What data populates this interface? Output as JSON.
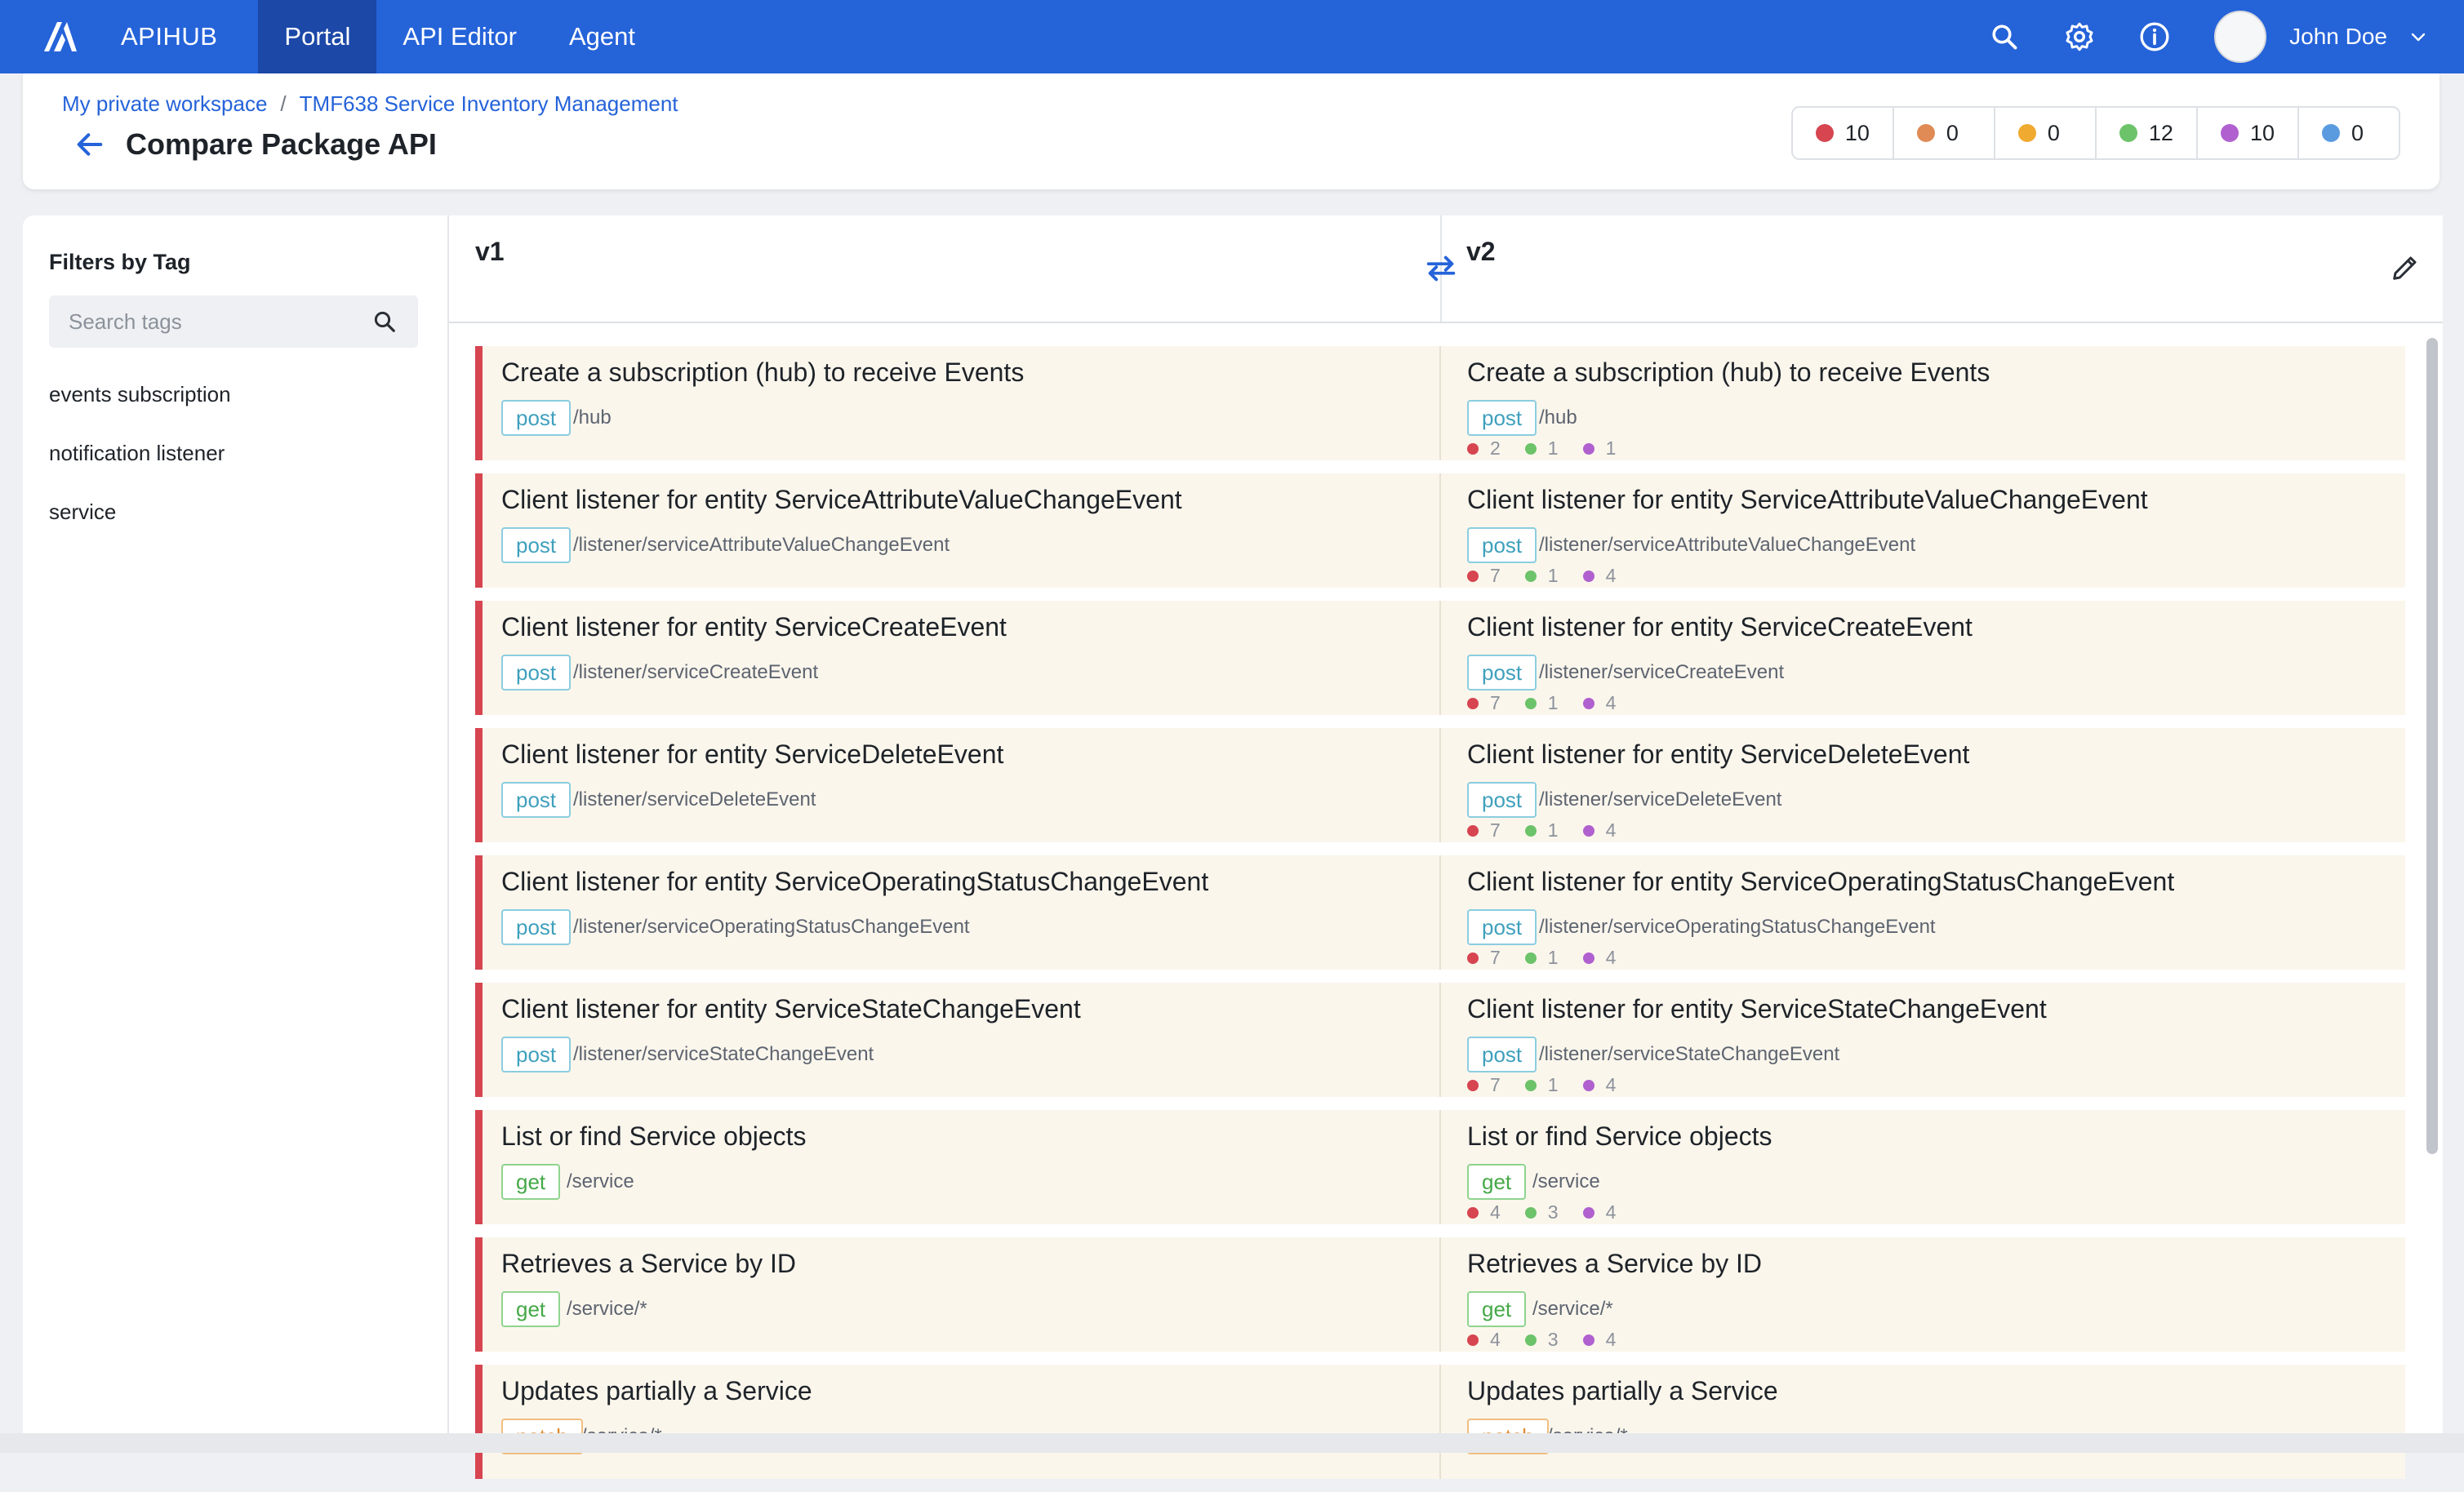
{
  "nav": {
    "brand": "APIHUB",
    "tabs": [
      {
        "label": "Portal",
        "active": true
      },
      {
        "label": "API Editor",
        "active": false
      },
      {
        "label": "Agent",
        "active": false
      }
    ],
    "user_name": "John Doe",
    "icons": [
      "search-icon",
      "settings-icon",
      "info-icon",
      "chevron-down-icon"
    ]
  },
  "header": {
    "breadcrumb": [
      "My private workspace",
      "TMF638 Service Inventory Management"
    ],
    "breadcrumb_separator": "/",
    "title": "Compare Package API",
    "counters": [
      {
        "color": "#d64550",
        "value": "10"
      },
      {
        "color": "#e08a55",
        "value": "0"
      },
      {
        "color": "#f0aa30",
        "value": "0"
      },
      {
        "color": "#6cc36a",
        "value": "12"
      },
      {
        "color": "#b060cf",
        "value": "10"
      },
      {
        "color": "#5a9be0",
        "value": "0"
      }
    ]
  },
  "sidebar": {
    "title": "Filters by Tag",
    "search_placeholder": "Search tags",
    "tags": [
      "events subscription",
      "notification listener",
      "service"
    ]
  },
  "compare": {
    "left_version": "v1",
    "right_version": "v2",
    "stat_colors": [
      "#d64550",
      "#6cc36a",
      "#b060cf"
    ],
    "rows": [
      {
        "title": "Create a subscription (hub) to receive Events",
        "method": "post",
        "path": "/hub",
        "stats": [
          "2",
          "1",
          "1"
        ]
      },
      {
        "title": "Client listener for entity ServiceAttributeValueChangeEvent",
        "method": "post",
        "path": "/listener/serviceAttributeValueChangeEvent",
        "stats": [
          "7",
          "1",
          "4"
        ]
      },
      {
        "title": "Client listener for entity ServiceCreateEvent",
        "method": "post",
        "path": "/listener/serviceCreateEvent",
        "stats": [
          "7",
          "1",
          "4"
        ]
      },
      {
        "title": "Client listener for entity ServiceDeleteEvent",
        "method": "post",
        "path": "/listener/serviceDeleteEvent",
        "stats": [
          "7",
          "1",
          "4"
        ]
      },
      {
        "title": "Client listener for entity ServiceOperatingStatusChangeEvent",
        "method": "post",
        "path": "/listener/serviceOperatingStatusChangeEvent",
        "stats": [
          "7",
          "1",
          "4"
        ]
      },
      {
        "title": "Client listener for entity ServiceStateChangeEvent",
        "method": "post",
        "path": "/listener/serviceStateChangeEvent",
        "stats": [
          "7",
          "1",
          "4"
        ]
      },
      {
        "title": "List or find Service objects",
        "method": "get",
        "path": "/service",
        "stats": [
          "4",
          "3",
          "4"
        ]
      },
      {
        "title": "Retrieves a Service by ID",
        "method": "get",
        "path": "/service/*",
        "stats": [
          "4",
          "3",
          "4"
        ]
      },
      {
        "title": "Updates partially a Service",
        "method": "patch",
        "path": "/service/*",
        "stats": []
      }
    ]
  }
}
